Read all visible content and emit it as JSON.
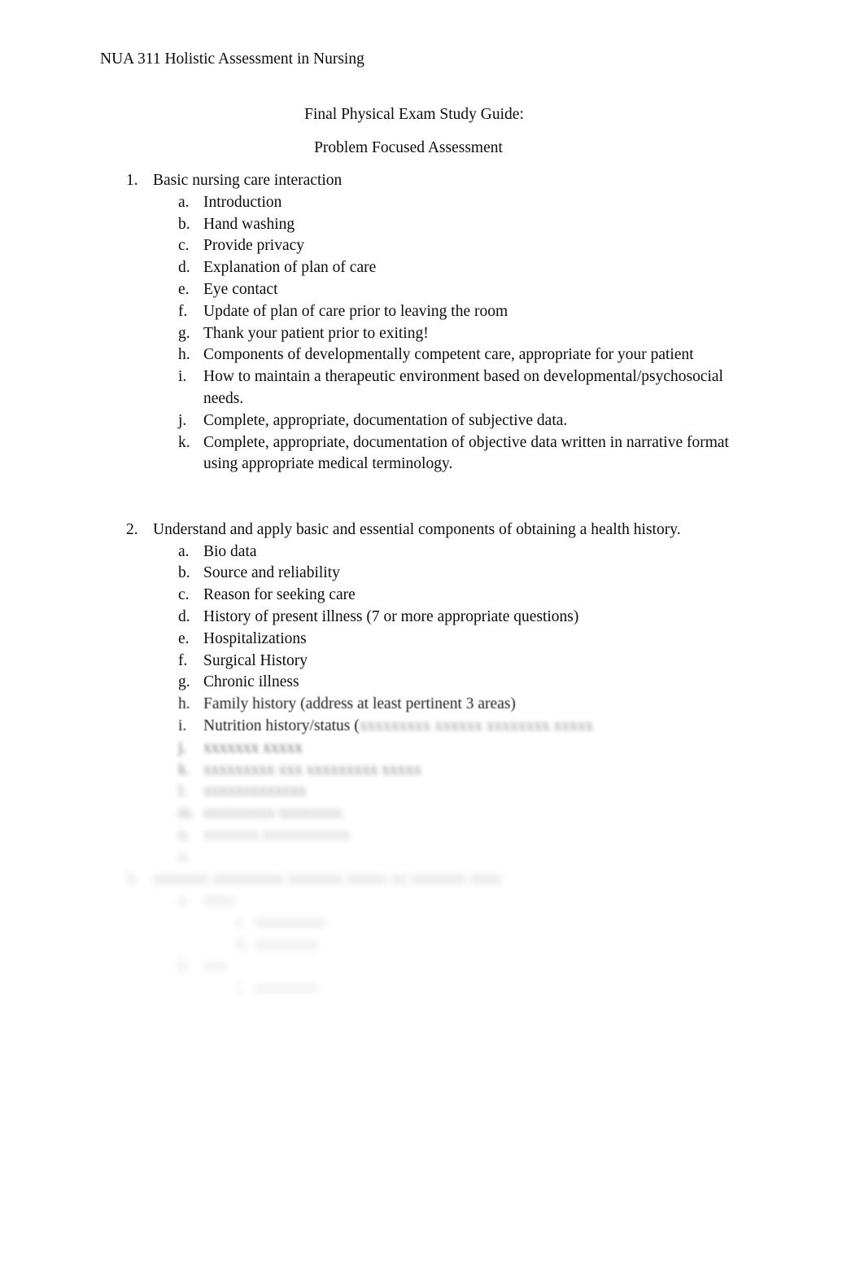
{
  "document": {
    "header": "NUA 311 Holistic Assessment in Nursing",
    "title_line_1": "Final Physical Exam Study Guide:",
    "title_line_2": "Problem Focused Assessment"
  },
  "sections": [
    {
      "number": "1.",
      "heading": "Basic nursing care interaction",
      "items": [
        {
          "marker": "a.",
          "text": "Introduction"
        },
        {
          "marker": "b.",
          "text": "Hand washing"
        },
        {
          "marker": "c.",
          "text": "Provide privacy"
        },
        {
          "marker": "d.",
          "text": "Explanation of plan of care"
        },
        {
          "marker": "e.",
          "text": "Eye contact"
        },
        {
          "marker": "f.",
          "text": "Update of plan of care prior to leaving the room"
        },
        {
          "marker": "g.",
          "text": "Thank your patient prior to exiting!"
        },
        {
          "marker": "h.",
          "text": "Components of developmentally competent care, appropriate for your patient"
        },
        {
          "marker": "i.",
          "text": "How to maintain a therapeutic environment based on developmental/psychosocial needs."
        },
        {
          "marker": "j.",
          "text": "Complete, appropriate, documentation of subjective data."
        },
        {
          "marker": "k.",
          "text": "Complete, appropriate, documentation of objective data written in narrative format using appropriate medical terminology."
        }
      ]
    },
    {
      "number": "2.",
      "heading": "Understand and apply basic and essential components of obtaining a health history.",
      "items": [
        {
          "marker": "a.",
          "text": "Bio data"
        },
        {
          "marker": "b.",
          "text": "Source and reliability"
        },
        {
          "marker": "c.",
          "text": "Reason for seeking care"
        },
        {
          "marker": "d.",
          "text": "History of present illness (7 or more  appropriate questions)"
        },
        {
          "marker": "e.",
          "text": "Hospitalizations"
        },
        {
          "marker": "f.",
          "text": "Surgical History"
        },
        {
          "marker": "g.",
          "text": "Chronic illness"
        },
        {
          "marker": "h.",
          "text": "Family history (address at least   pertinent 3 areas)"
        }
      ],
      "item_i_visible": "Nutrition history/status (",
      "item_i_obscured": "xxxxxxxxx xxxxxx   xxxxxxxx xxxxx"
    }
  ],
  "obscured": {
    "note": "Text below is blurred beyond legibility in the source image; placeholders preserve line position and approximate extent only.",
    "section2_tail": [
      {
        "marker": "j.",
        "text": "xxxxxxx xxxxx"
      },
      {
        "marker": "k.",
        "text": "xxxxxxxxx xxx xxxxxxxxx xxxxx"
      },
      {
        "marker": "l.",
        "text": "xxxxxxxxxxxxx"
      },
      {
        "marker": "m.",
        "text": "xxxxxxxxx xxxxxxxx"
      },
      {
        "marker": "n.",
        "text": "xxxxxxx xxxxxxxxxxx"
      },
      {
        "marker": "o.",
        "text": ""
      }
    ],
    "section3": {
      "number": "3.",
      "heading": "xxxxxxx xxxxxxxxx xxxxxxx xxxxx xx xxxxxxx xxxx",
      "items": [
        {
          "marker": "a.",
          "text": "xxxx",
          "subitems": [
            {
              "marker": "i.",
              "text": "xxxxxxxxx"
            },
            {
              "marker": "ii.",
              "text": "xxxxxxxx"
            }
          ]
        },
        {
          "marker": "b.",
          "text": "xxx",
          "subitems": [
            {
              "marker": "i.",
              "text": "xxxxxxxx"
            }
          ]
        }
      ]
    }
  }
}
